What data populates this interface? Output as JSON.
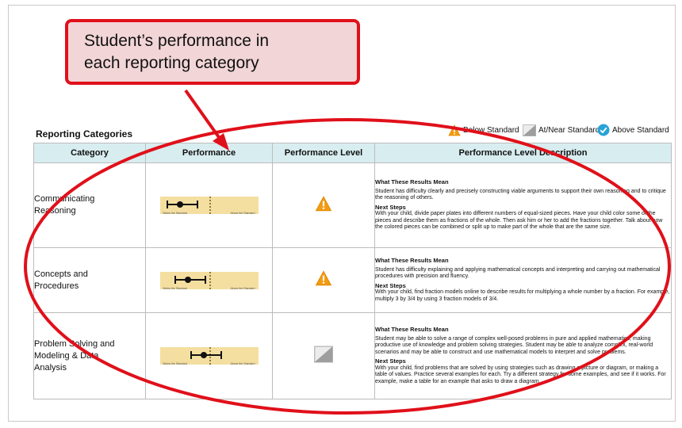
{
  "callout": {
    "line1": "Student’s performance in",
    "line2": "each reporting category"
  },
  "section_title": "Reporting Categories",
  "legend": [
    {
      "label": "Below Standard",
      "icon": "warning-triangle-icon",
      "color": "#f39c12"
    },
    {
      "label": "At/Near Standard",
      "icon": "gray-split-square-icon",
      "color": "#9e9e9e"
    },
    {
      "label": "Above Standard",
      "icon": "check-circle-icon",
      "color": "#29a3d6"
    }
  ],
  "table": {
    "headers": [
      "Category",
      "Performance",
      "Performance Level",
      "Performance Level Description"
    ],
    "rows": [
      {
        "category_line1": "Communicating",
        "category_line2": "Reasoning",
        "category_line3": "",
        "bar_low_label": "Below the Standard",
        "bar_high_label": "Above the Standard",
        "score_fraction": 0.2,
        "level": "Below Standard",
        "what_heading": "What These Results Mean",
        "what_text": "Student has difficulty clearly and precisely constructing viable arguments to support their own reasoning and to critique the reasoning of others.",
        "next_heading": "Next Steps",
        "next_text": "With your child, divide paper plates into different numbers of equal-sized pieces. Have your child color some of the pieces and describe them as fractions of the whole. Then ask him or her to add the fractions together. Talk about how the colored pieces can be combined or split up to make part of the whole that are the same size."
      },
      {
        "category_line1": "Concepts and",
        "category_line2": "Procedures",
        "category_line3": "",
        "bar_low_label": "Below the Standard",
        "bar_high_label": "Above the Standard",
        "score_fraction": 0.28,
        "level": "Below Standard",
        "what_heading": "What These Results Mean",
        "what_text": "Student has difficulty explaining and applying mathematical concepts and interpreting and carrying out mathematical procedures with precision and fluency.",
        "next_heading": "Next Steps",
        "next_text": "With your child, find fraction models online to describe results for multiplying a whole number by a fraction. For example, multiply 3 by 3/4 by using 3 fraction models of 3/4."
      },
      {
        "category_line1": "Problem Solving and",
        "category_line2": "Modeling & Data",
        "category_line3": "Analysis",
        "bar_low_label": "Below the Standard",
        "bar_high_label": "Above the Standard",
        "score_fraction": 0.44,
        "level": "At/Near Standard",
        "what_heading": "What These Results Mean",
        "what_text": "Student may be able to solve a range of complex well-posed problems in pure and applied mathematics, making productive use of knowledge and problem solving strategies. Student may be able to analyze complex, real-world scenarios and may be able to construct and use mathematical models to interpret and solve problems.",
        "next_heading": "Next Steps",
        "next_text": "With your child, find problems that are solved by using strategies such as drawing a picture or diagram, or making a table of values. Practice several examples for each. Try a different strategy for some examples, and see if it works. For example, make a table for an example that asks to draw a diagram."
      }
    ]
  },
  "colors": {
    "callout_border": "#e0101a",
    "callout_fill": "#f2d5d7",
    "header_fill": "#d8edf0",
    "bar_fill": "#f4dfa0",
    "annotation_red": "#e0101a"
  }
}
